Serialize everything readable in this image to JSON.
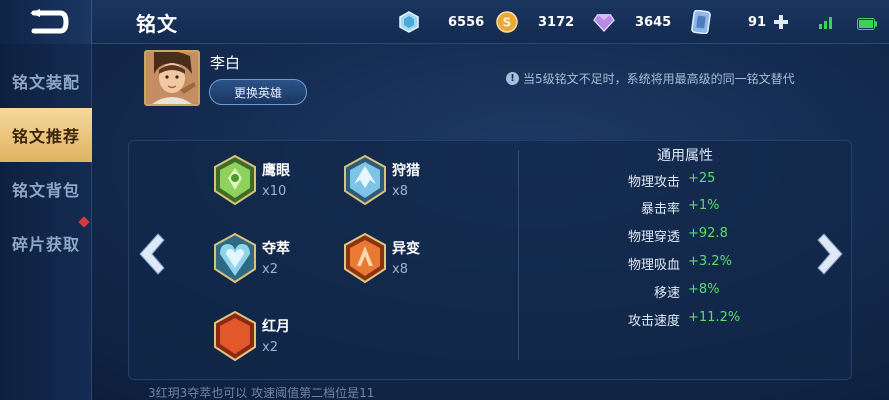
{
  "header": {
    "title": "铭文",
    "resources": [
      {
        "icon": "crystal-icon",
        "value": "6556"
      },
      {
        "icon": "gold-coin-icon",
        "value": "3172"
      },
      {
        "icon": "diamond-icon",
        "value": "3645"
      },
      {
        "icon": "card-icon",
        "value": "91"
      }
    ]
  },
  "sidebar": {
    "items": [
      {
        "label": "铭文装配"
      },
      {
        "label": "铭文推荐"
      },
      {
        "label": "铭文背包"
      },
      {
        "label": "碎片获取"
      }
    ]
  },
  "hero": {
    "name": "李白",
    "change_label": "更换英雄"
  },
  "notice": "当5级铭文不足时，系统将用最高级的同一铭文替代",
  "runes": [
    {
      "name": "鹰眼",
      "count": "x10",
      "color": "#7cc04a"
    },
    {
      "name": "狩猎",
      "count": "x8",
      "color": "#6fb2d8"
    },
    {
      "name": "夺萃",
      "count": "x2",
      "color": "#7fc6e0"
    },
    {
      "name": "异变",
      "count": "x8",
      "color": "#e0782e"
    },
    {
      "name": "红月",
      "count": "x2",
      "color": "#e2582a"
    }
  ],
  "attributes": {
    "title": "通用属性",
    "items": [
      {
        "name": "物理攻击",
        "value": "+25"
      },
      {
        "name": "暴击率",
        "value": "+1%"
      },
      {
        "name": "物理穿透",
        "value": "+92.8"
      },
      {
        "name": "物理吸血",
        "value": "+3.2%"
      },
      {
        "name": "移速",
        "value": "+8%"
      },
      {
        "name": "攻击速度",
        "value": "+11.2%"
      }
    ]
  },
  "footnote": "3红玥3夺萃也可以 攻速阈值第二档位是11",
  "colors": {
    "accent_gold": "#e0b362",
    "positive_green": "#5fdc6a",
    "panel_blue": "#132a4e"
  }
}
